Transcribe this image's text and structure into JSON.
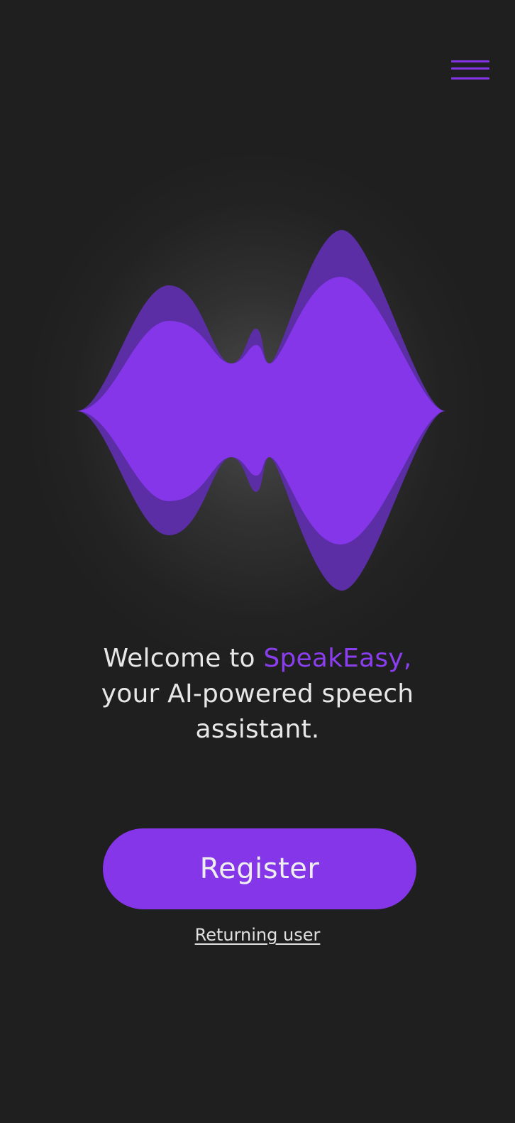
{
  "app": {
    "name": "SpeakEasy"
  },
  "colors": {
    "background": "#1f1f1f",
    "accent": "#8536e9",
    "accent_dark": "#5b2ea6",
    "text": "#e7e7e7"
  },
  "header": {
    "menu_icon": "hamburger-menu-icon"
  },
  "hero": {
    "illustration_icon": "sound-wave-icon"
  },
  "welcome": {
    "prefix": "Welcome to ",
    "brand": "SpeakEasy,",
    "line2": "your AI-powered speech",
    "line3": "assistant."
  },
  "actions": {
    "register_label": "Register",
    "returning_label": "Returning user"
  }
}
